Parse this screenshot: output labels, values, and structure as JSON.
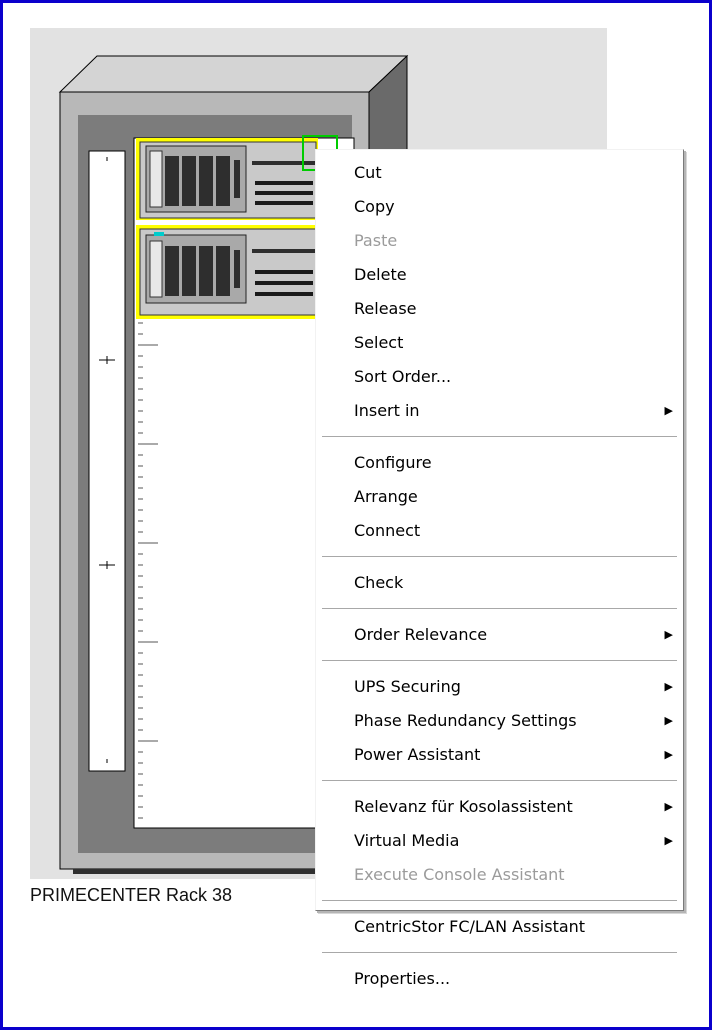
{
  "rack": {
    "label": "PRIMECENTER Rack 38"
  },
  "context_menu": {
    "groups": [
      [
        {
          "label": "Cut",
          "enabled": true,
          "submenu": false
        },
        {
          "label": "Copy",
          "enabled": true,
          "submenu": false
        },
        {
          "label": "Paste",
          "enabled": false,
          "submenu": false
        },
        {
          "label": "Delete",
          "enabled": true,
          "submenu": false
        },
        {
          "label": "Release",
          "enabled": true,
          "submenu": false
        },
        {
          "label": "Select",
          "enabled": true,
          "submenu": false
        },
        {
          "label": "Sort Order...",
          "enabled": true,
          "submenu": false
        },
        {
          "label": "Insert in",
          "enabled": true,
          "submenu": true
        }
      ],
      [
        {
          "label": "Configure",
          "enabled": true,
          "submenu": false
        },
        {
          "label": "Arrange",
          "enabled": true,
          "submenu": false
        },
        {
          "label": "Connect",
          "enabled": true,
          "submenu": false
        }
      ],
      [
        {
          "label": "Check",
          "enabled": true,
          "submenu": false
        }
      ],
      [
        {
          "label": "Order Relevance",
          "enabled": true,
          "submenu": true
        }
      ],
      [
        {
          "label": "UPS Securing",
          "enabled": true,
          "submenu": true
        },
        {
          "label": "Phase Redundancy Settings",
          "enabled": true,
          "submenu": true
        },
        {
          "label": "Power Assistant",
          "enabled": true,
          "submenu": true
        }
      ],
      [
        {
          "label": "Relevanz für Kosolassistent",
          "enabled": true,
          "submenu": true
        },
        {
          "label": "Virtual Media",
          "enabled": true,
          "submenu": true
        },
        {
          "label": "Execute Console Assistant",
          "enabled": false,
          "submenu": false
        }
      ],
      [
        {
          "label": "CentricStor FC/LAN Assistant",
          "enabled": true,
          "submenu": false
        }
      ],
      [
        {
          "label": "Properties...",
          "enabled": true,
          "submenu": false
        }
      ]
    ],
    "submenu_arrow": "▶"
  },
  "colors": {
    "frame_border": "#0b00cc",
    "selection_handle": "#ffff00",
    "selection_green": "#00cc00",
    "disabled_text": "#9b9b9b"
  }
}
